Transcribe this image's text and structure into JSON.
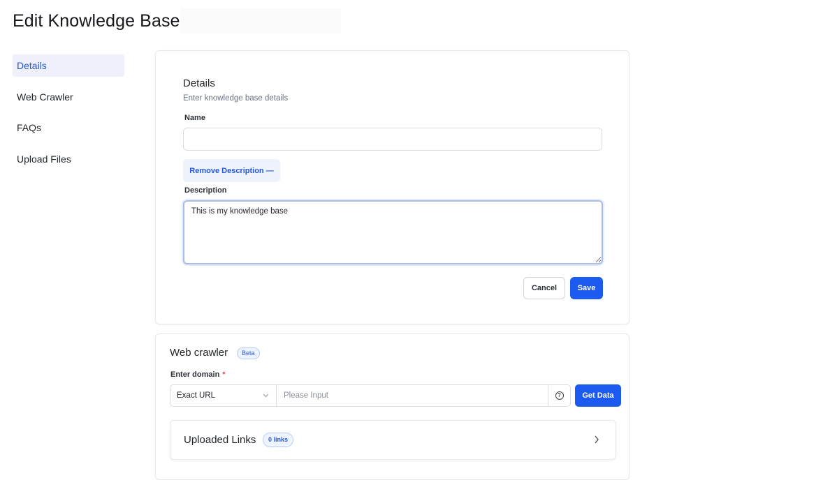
{
  "page": {
    "title": "Edit Knowledge Base"
  },
  "sidebar": {
    "items": [
      {
        "label": "Details",
        "active": true
      },
      {
        "label": "Web Crawler",
        "active": false
      },
      {
        "label": "FAQs",
        "active": false
      },
      {
        "label": "Upload Files",
        "active": false
      }
    ]
  },
  "details": {
    "title": "Details",
    "subtitle": "Enter knowledge base details",
    "name_label": "Name",
    "name_value": "",
    "remove_description_label": "Remove Description —",
    "description_label": "Description",
    "description_value": "This is my knowledge base",
    "cancel_label": "Cancel",
    "save_label": "Save"
  },
  "crawler": {
    "title": "Web crawler",
    "badge": "Beta",
    "domain_label": "Enter domain",
    "required_mark": "*",
    "url_type_selected": "Exact URL",
    "url_placeholder": "Please Input",
    "help_icon": "question-circle-icon",
    "get_data_label": "Get Data",
    "uploaded_links_title": "Uploaded Links",
    "links_count_badge": "0 links"
  },
  "colors": {
    "accent": "#1d5bf0",
    "active_bg": "#eef1fb",
    "border": "#e6e8ec"
  }
}
